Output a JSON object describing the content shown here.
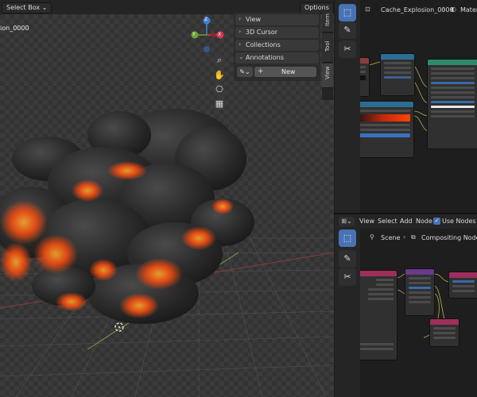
{
  "viewport": {
    "header": {
      "select_mode": "Select Box",
      "options_label": "Options"
    },
    "title": "ion_0000",
    "axis_labels": {
      "z": "Z",
      "y": "Y",
      "x": "X"
    },
    "sidebar": {
      "panels": [
        "View",
        "3D Cursor",
        "Collections",
        "Annotations"
      ],
      "new_button": "New",
      "tabs": [
        "Item",
        "Tool",
        "View"
      ],
      "active_tab": "View"
    }
  },
  "shader_editor": {
    "breadcrumb_object": "Cache_Explosion_0000",
    "breadcrumb_material": "Mater",
    "tools": [
      "select-tool",
      "annotate-tool",
      "links-cut-tool"
    ]
  },
  "compositor": {
    "menus": [
      "View",
      "Select",
      "Add",
      "Node"
    ],
    "use_nodes_label": "Use Nodes",
    "use_nodes_checked": true,
    "breadcrumb_scene": "Scene",
    "breadcrumb_tree": "Compositing Nodetree"
  },
  "colors": {
    "accent": "#4772b3",
    "fire": "#ff5a14",
    "smoke": "#2e2e2e",
    "axis_x": "#d9394e",
    "axis_y": "#6ca532",
    "axis_z": "#3f82d8"
  }
}
